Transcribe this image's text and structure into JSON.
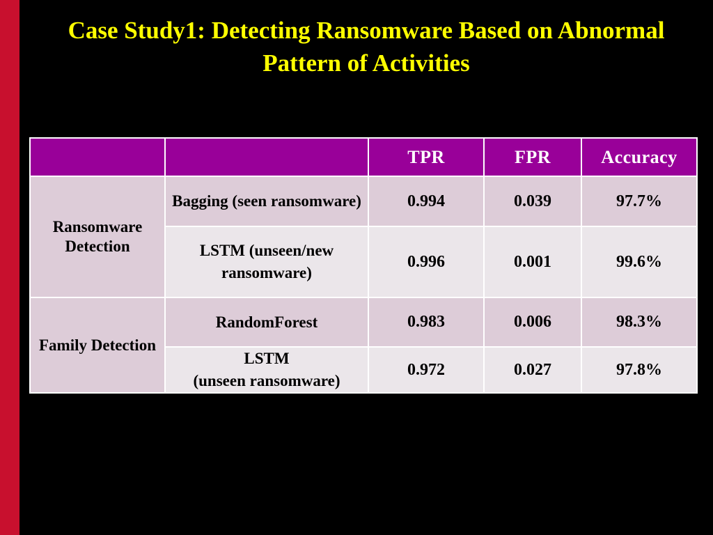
{
  "slide": {
    "title": "Case Study1: Detecting Ransomware Based on Abnormal Pattern of Activities",
    "title_line1": "Case Study1: Detecting Ransomware Based on Abnormal",
    "title_line2": "Pattern of Activities",
    "background_color": "#000000",
    "title_color": "#FFFF00",
    "accent_stripe_color": "#C8102E"
  },
  "table": {
    "header_bg": "#990099",
    "header_text_color": "#FFFFFF",
    "row_bg_dark": "#DDCCD8",
    "row_bg_light": "#EBE6EA",
    "headers": [
      "",
      "",
      "TPR",
      "FPR",
      "Accuracy"
    ],
    "groups": [
      {
        "label": "Ransomware Detection",
        "label_line1": "Ransomware",
        "label_line2": "Detection",
        "rowspan": 2
      },
      {
        "label": "Family Detection",
        "label_line1": "Family",
        "label_line2": "Detection",
        "rowspan": 2
      }
    ],
    "rows": [
      {
        "group": "Ransomware Detection",
        "method": "Bagging (seen ransomware)",
        "method_line1": "Bagging",
        "method_line2": "(seen ransomware)",
        "tpr": "0.994",
        "fpr": "0.039",
        "accuracy": "97.7%"
      },
      {
        "group": "Ransomware Detection",
        "method": "LSTM (unseen/new ransomware)",
        "method_line1": "LSTM",
        "method_line2": "(unseen/new",
        "method_line3": "ransomware)",
        "tpr": "0.996",
        "fpr": "0.001",
        "accuracy": "99.6%"
      },
      {
        "group": "Family Detection",
        "method": "RandomForest",
        "method_line1": "RandomForest",
        "tpr": "0.983",
        "fpr": "0.006",
        "accuracy": "98.3%"
      },
      {
        "group": "Family Detection",
        "method": "LSTM (unseen ransomware)",
        "method_line1": "LSTM",
        "method_line2": "(unseen ransomware)",
        "tpr": "0.972",
        "fpr": "0.027",
        "accuracy": "97.8%"
      }
    ]
  }
}
